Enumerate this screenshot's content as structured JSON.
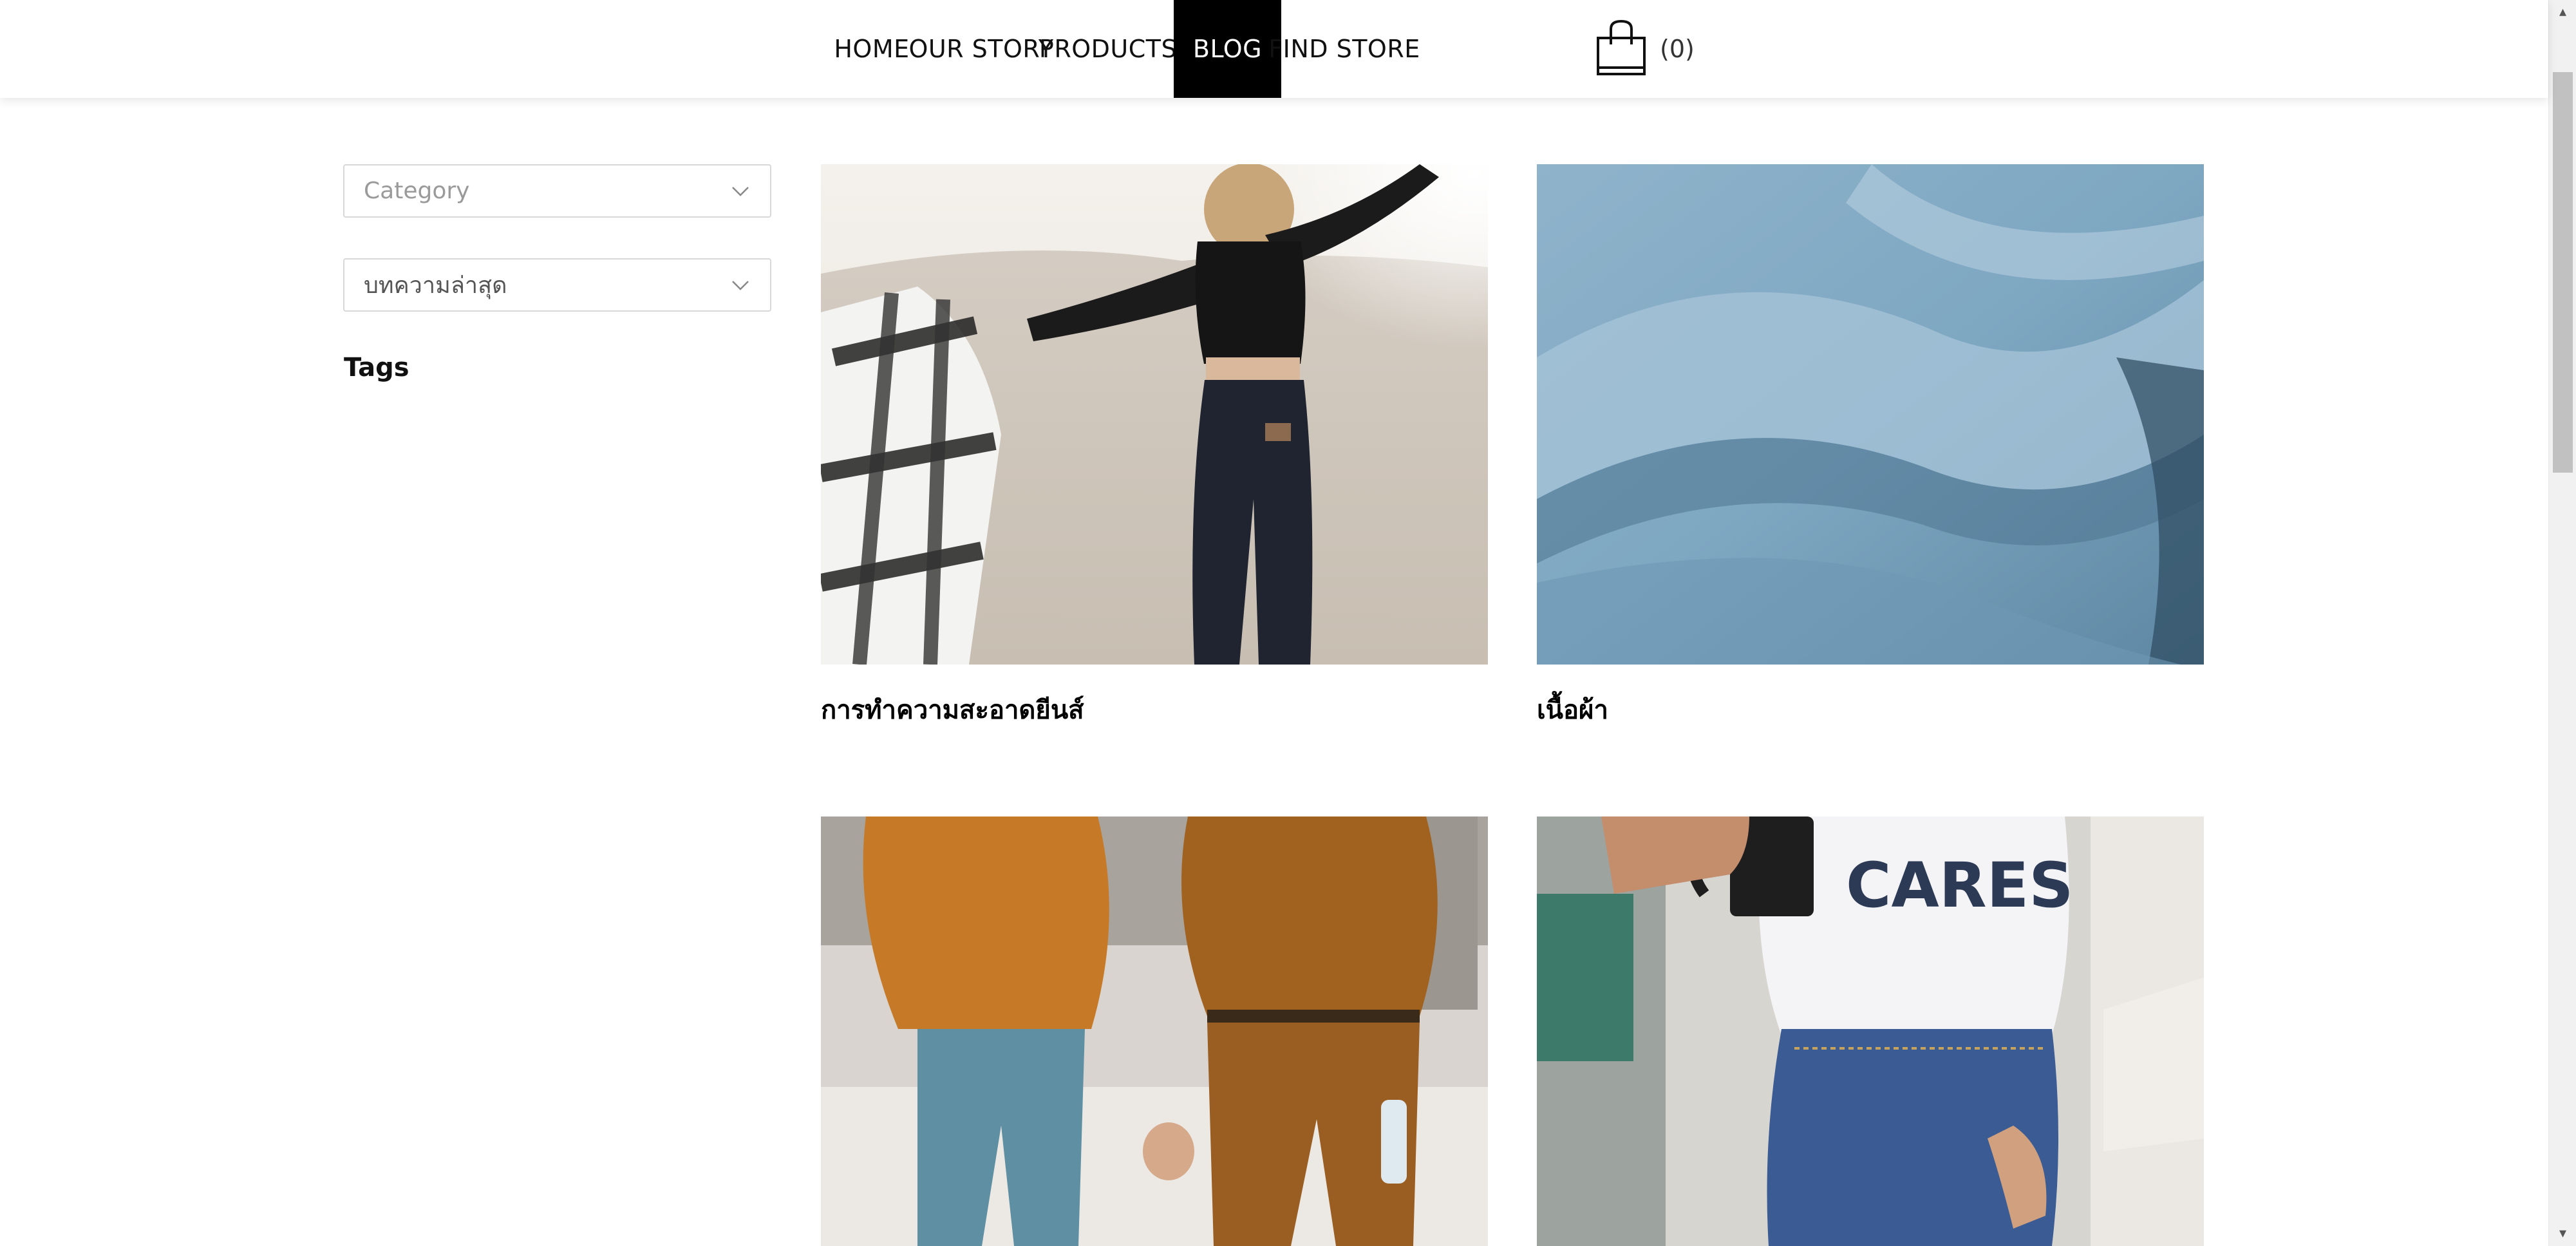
{
  "nav": {
    "items": [
      {
        "label": "HOME",
        "active": false
      },
      {
        "label": "OUR STORY",
        "active": false
      },
      {
        "label": "PRODUCTS",
        "active": false
      },
      {
        "label": "BLOG",
        "active": true
      },
      {
        "label": "FIND STORE",
        "active": false
      }
    ],
    "cart": {
      "icon": "shopping-bag-icon",
      "count": "(0)"
    }
  },
  "sidebar": {
    "category_select": {
      "value": "Category",
      "icon": "chevron-down-icon"
    },
    "latest_select": {
      "value": "บทความล่าสุด",
      "icon": "chevron-down-icon"
    },
    "tags_title": "Tags"
  },
  "posts": [
    {
      "title": "การทำความสะอาดยีนส์",
      "image": "woman-on-beach-photo"
    },
    {
      "title": "เนื้อผ้า",
      "image": "denim-fabric-photo"
    },
    {
      "title": "",
      "image": "couple-holding-hands-photo"
    },
    {
      "title": "",
      "image": "person-with-mug-photo"
    }
  ],
  "colors": {
    "accent": "#000000",
    "nav_text": "#111111",
    "border": "#d8d8d8",
    "placeholder": "#9a9a9a"
  }
}
